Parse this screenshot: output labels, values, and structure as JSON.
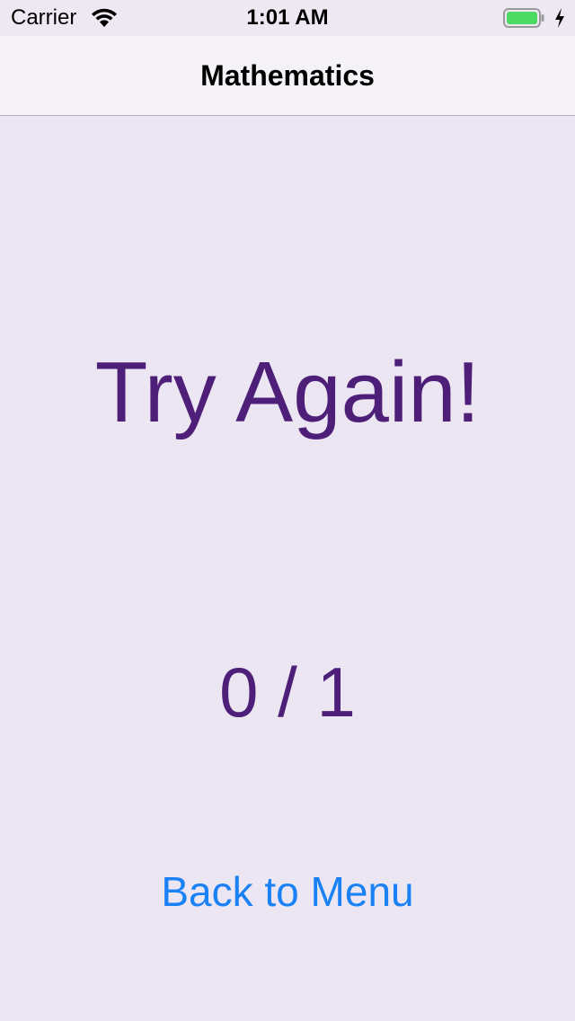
{
  "status_bar": {
    "carrier": "Carrier",
    "time": "1:01 AM",
    "wifi_icon": "wifi-icon",
    "battery_icon": "battery-icon",
    "battery_level": 1.0,
    "battery_color": "#4CD964",
    "charging_icon": "charging-bolt-icon"
  },
  "nav": {
    "title": "Mathematics"
  },
  "result": {
    "message": "Try Again!",
    "score": "0 / 1"
  },
  "actions": {
    "back_label": "Back to Menu"
  },
  "colors": {
    "background": "#ECE6F2",
    "accent_purple": "#4E1F78",
    "link_blue": "#1A82F5"
  }
}
